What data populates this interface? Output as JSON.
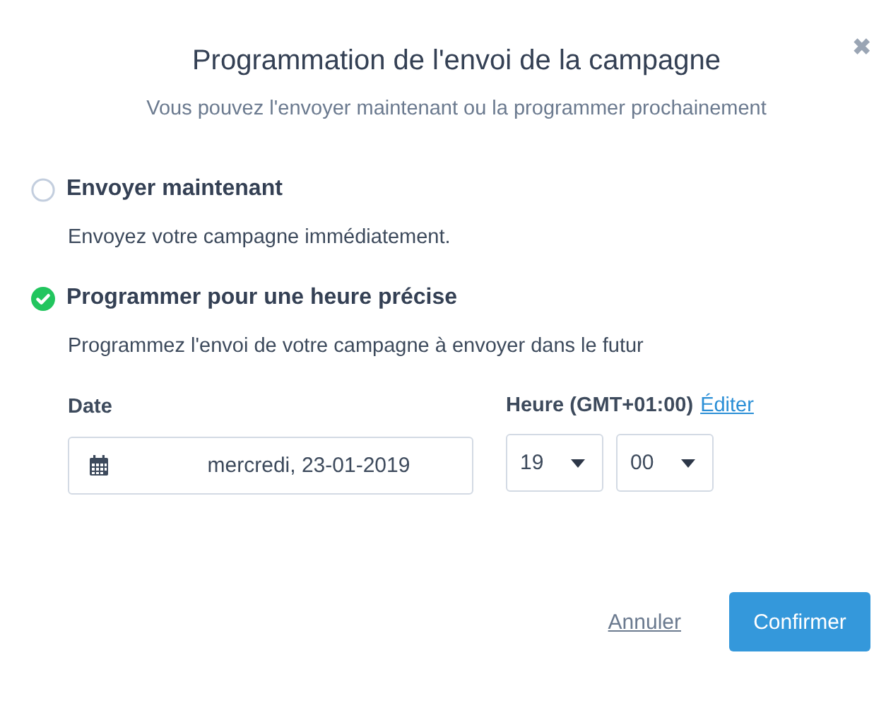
{
  "dialog": {
    "title": "Programmation de l'envoi de la campagne",
    "subtitle": "Vous pouvez l'envoyer maintenant ou la programmer prochainement",
    "close": "✖"
  },
  "options": [
    {
      "label": "Envoyer maintenant",
      "description": "Envoyez votre campagne immédiatement.",
      "selected": false
    },
    {
      "label": "Programmer pour une heure précise",
      "description": "Programmez l'envoi de votre campagne à envoyer dans le futur",
      "selected": true
    }
  ],
  "schedule": {
    "date_label": "Date",
    "date_value": "mercredi, 23-01-2019",
    "time_label": "Heure (GMT+01:00)",
    "edit_link": "Éditer",
    "hour": "19",
    "minute": "00"
  },
  "buttons": {
    "cancel": "Annuler",
    "confirm": "Confirmer"
  }
}
